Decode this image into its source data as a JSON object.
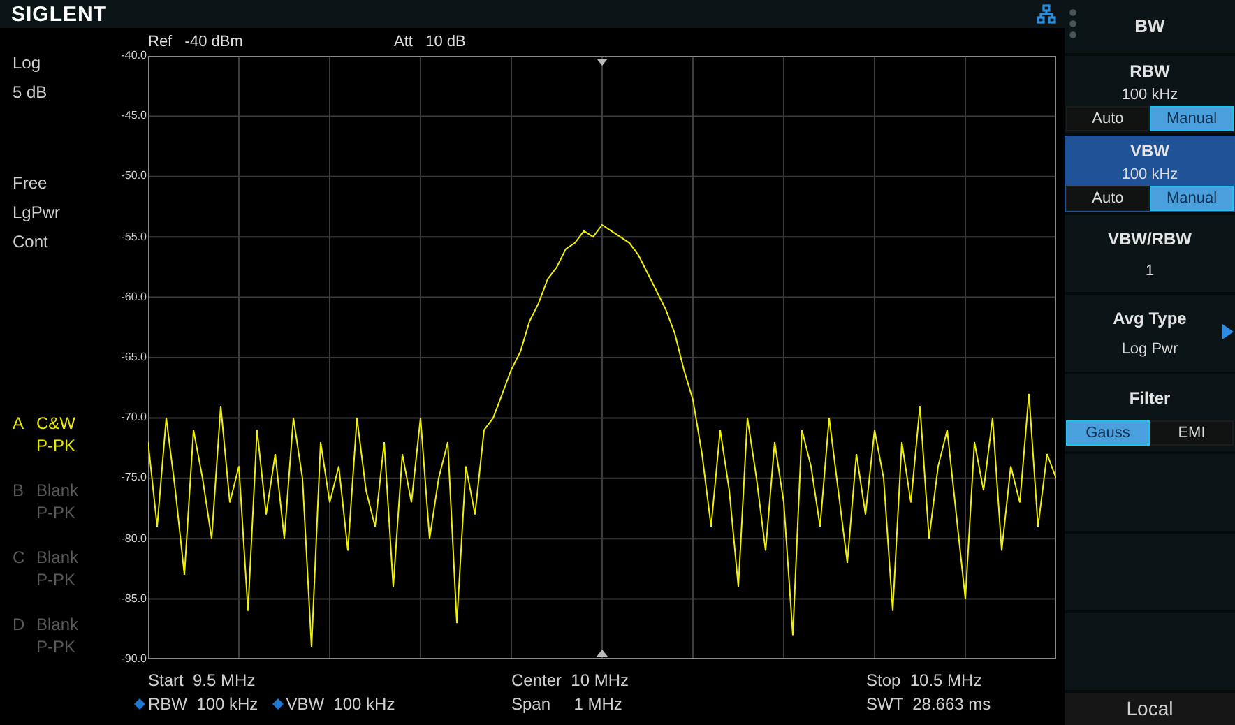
{
  "header": {
    "logo": "SIGLENT"
  },
  "ref": {
    "label": "Ref",
    "value": "-40 dBm"
  },
  "att": {
    "label": "Att",
    "value": "10 dB"
  },
  "scale_info": [
    "Log",
    "5 dB"
  ],
  "mode_info": [
    "Free",
    "LgPwr",
    "Cont"
  ],
  "traces": [
    {
      "letter": "A",
      "name": "C&W",
      "detector": "P-PK",
      "active": true
    },
    {
      "letter": "B",
      "name": "Blank",
      "detector": "P-PK",
      "active": false
    },
    {
      "letter": "C",
      "name": "Blank",
      "detector": "P-PK",
      "active": false
    },
    {
      "letter": "D",
      "name": "Blank",
      "detector": "P-PK",
      "active": false
    }
  ],
  "spectrum": {
    "chart_data": {
      "type": "line",
      "grid": true,
      "ylim": [
        -90,
        -40
      ],
      "yticks": [
        {
          "value": -40,
          "label": "-40.0"
        },
        {
          "value": -45,
          "label": "-45.0"
        },
        {
          "value": -50,
          "label": "-50.0"
        },
        {
          "value": -55,
          "label": "-55.0"
        },
        {
          "value": -60,
          "label": "-60.0"
        },
        {
          "value": -65,
          "label": "-65.0"
        },
        {
          "value": -70,
          "label": "-70.0"
        },
        {
          "value": -75,
          "label": "-75.0"
        },
        {
          "value": -80,
          "label": "-80.0"
        },
        {
          "value": -85,
          "label": "-85.0"
        },
        {
          "value": -90,
          "label": "-90.0"
        }
      ],
      "categories": [
        null,
        null,
        null,
        null,
        null,
        null,
        null,
        null,
        null,
        null,
        null,
        null,
        null,
        null,
        null,
        null,
        null,
        null,
        null,
        null,
        null,
        null,
        null,
        null,
        null,
        null,
        null,
        null,
        null,
        null,
        null,
        null,
        null,
        null,
        null,
        null,
        null,
        null,
        null,
        null,
        null,
        null,
        null,
        null,
        null,
        null,
        null,
        null,
        null,
        null,
        null,
        null,
        null,
        null,
        null,
        null,
        null,
        null,
        null,
        null,
        null,
        null,
        null,
        null,
        null,
        null,
        null,
        null,
        null,
        null,
        null,
        null,
        null,
        null,
        null,
        null,
        null,
        null,
        null,
        null,
        null,
        null,
        null,
        null,
        null,
        null,
        null,
        null,
        null,
        null,
        null,
        null,
        null,
        null,
        null,
        null,
        null,
        null,
        null,
        null,
        null
      ],
      "series": [
        {
          "color": "#f0f000",
          "values": [
            -72,
            -79,
            -70,
            -76,
            -83,
            -71,
            -75,
            -80,
            -69,
            -77,
            -74,
            -86,
            -71,
            -78,
            -73,
            -80,
            -70,
            -75,
            -89,
            -72,
            -77,
            -74,
            -81,
            -70,
            -76,
            -79,
            -72,
            -84,
            -73,
            -77,
            -70,
            -80,
            -75,
            -72,
            -87,
            -74,
            -78,
            -71,
            -70,
            -68,
            -66,
            -64.5,
            -62,
            -60.5,
            -58.5,
            -57.5,
            -56,
            -55.5,
            -54.5,
            -55,
            -54,
            -54.5,
            -55,
            -55.5,
            -56.5,
            -58,
            -59.5,
            -61,
            -63,
            -66,
            -68.5,
            -73,
            -79,
            -71,
            -76,
            -84,
            -70,
            -75,
            -81,
            -72,
            -77,
            -88,
            -71,
            -74,
            -79,
            -70,
            -76,
            -82,
            -73,
            -78,
            -71,
            -75,
            -86,
            -72,
            -77,
            -69,
            -80,
            -74,
            -71,
            -78,
            -85,
            -72,
            -76,
            -70,
            -81,
            -74,
            -77,
            -68,
            -79,
            -73,
            -75
          ]
        }
      ]
    }
  },
  "footer": {
    "start": {
      "label": "Start",
      "value": "9.5 MHz"
    },
    "center": {
      "label": "Center",
      "value": "10 MHz"
    },
    "stop": {
      "label": "Stop",
      "value": "10.5 MHz"
    },
    "bandwidths": [
      {
        "label": "RBW",
        "value": "100 kHz"
      },
      {
        "label": "VBW",
        "value": "100 kHz"
      }
    ],
    "span": {
      "label": "Span",
      "value": "1 MHz"
    },
    "swt": {
      "label": "SWT",
      "value": "28.663 ms"
    }
  },
  "menu": {
    "title": "BW",
    "items": [
      {
        "kind": "toggle",
        "label": "RBW",
        "value": "100 kHz",
        "selected": false,
        "options": [
          {
            "label": "Auto",
            "selected": false
          },
          {
            "label": "Manual",
            "selected": true
          }
        ]
      },
      {
        "kind": "toggle",
        "label": "VBW",
        "value": "100 kHz",
        "selected": true,
        "options": [
          {
            "label": "Auto",
            "selected": false
          },
          {
            "label": "Manual",
            "selected": true
          }
        ]
      },
      {
        "kind": "value",
        "label": "VBW/RBW",
        "value": "1",
        "selected": false
      },
      {
        "kind": "submenu",
        "label": "Avg Type",
        "value": "Log Pwr",
        "selected": false
      },
      {
        "kind": "choice",
        "label": "Filter",
        "selected": false,
        "options": [
          {
            "label": "Gauss",
            "selected": true
          },
          {
            "label": "EMI",
            "selected": false
          }
        ]
      },
      {
        "kind": "empty",
        "selected": false
      },
      {
        "kind": "empty",
        "selected": false
      },
      {
        "kind": "empty",
        "selected": false
      }
    ]
  },
  "status": "Local"
}
